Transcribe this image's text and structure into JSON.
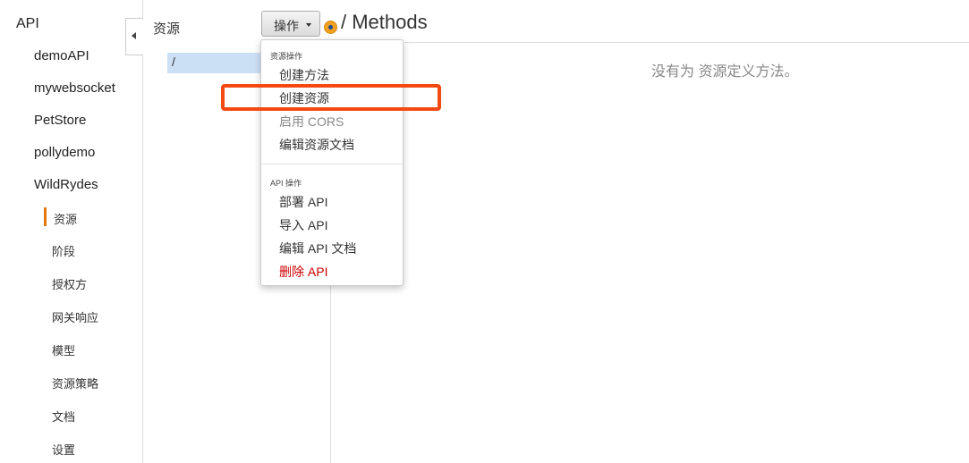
{
  "nav": {
    "title": "API",
    "apis": [
      "demoAPI",
      "mywebsocket",
      "PetStore",
      "pollydemo",
      "WildRydes"
    ],
    "sub_items": [
      "资源",
      "阶段",
      "授权方",
      "网关响应",
      "模型",
      "资源策略",
      "文档",
      "设置"
    ],
    "active_sub_item": "资源"
  },
  "resources": {
    "title": "资源",
    "tree_root": "/"
  },
  "actions": {
    "label": "操作"
  },
  "menu": {
    "resource_section": "资源操作",
    "create_method": "创建方法",
    "create_resource": "创建资源",
    "enable_cors": "启用 CORS",
    "edit_resource_docs": "编辑资源文档",
    "api_section": "API 操作",
    "deploy_api": "部署 API",
    "import_api": "导入 API",
    "edit_api_docs": "编辑 API 文档",
    "delete_api": "删除 API"
  },
  "main": {
    "title": "/ Methods",
    "empty_message": "没有为 资源定义方法。"
  },
  "colors": {
    "active_bar": "#e47911",
    "highlight": "#f24a12",
    "danger": "#cc0000",
    "selected_row": "#cce0f5"
  }
}
